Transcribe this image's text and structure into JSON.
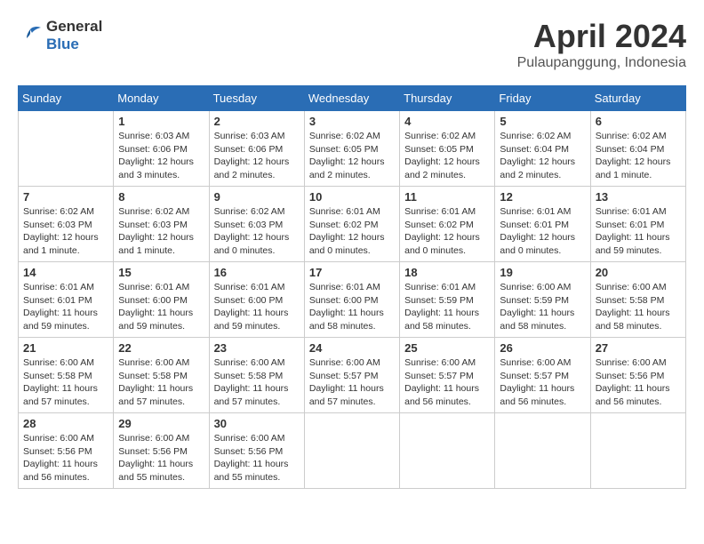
{
  "header": {
    "logo_line1": "General",
    "logo_line2": "Blue",
    "month_title": "April 2024",
    "location": "Pulaupanggung, Indonesia"
  },
  "weekdays": [
    "Sunday",
    "Monday",
    "Tuesday",
    "Wednesday",
    "Thursday",
    "Friday",
    "Saturday"
  ],
  "weeks": [
    [
      {
        "day": "",
        "info": ""
      },
      {
        "day": "1",
        "info": "Sunrise: 6:03 AM\nSunset: 6:06 PM\nDaylight: 12 hours\nand 3 minutes."
      },
      {
        "day": "2",
        "info": "Sunrise: 6:03 AM\nSunset: 6:06 PM\nDaylight: 12 hours\nand 2 minutes."
      },
      {
        "day": "3",
        "info": "Sunrise: 6:02 AM\nSunset: 6:05 PM\nDaylight: 12 hours\nand 2 minutes."
      },
      {
        "day": "4",
        "info": "Sunrise: 6:02 AM\nSunset: 6:05 PM\nDaylight: 12 hours\nand 2 minutes."
      },
      {
        "day": "5",
        "info": "Sunrise: 6:02 AM\nSunset: 6:04 PM\nDaylight: 12 hours\nand 2 minutes."
      },
      {
        "day": "6",
        "info": "Sunrise: 6:02 AM\nSunset: 6:04 PM\nDaylight: 12 hours\nand 1 minute."
      }
    ],
    [
      {
        "day": "7",
        "info": "Sunrise: 6:02 AM\nSunset: 6:03 PM\nDaylight: 12 hours\nand 1 minute."
      },
      {
        "day": "8",
        "info": "Sunrise: 6:02 AM\nSunset: 6:03 PM\nDaylight: 12 hours\nand 1 minute."
      },
      {
        "day": "9",
        "info": "Sunrise: 6:02 AM\nSunset: 6:03 PM\nDaylight: 12 hours\nand 0 minutes."
      },
      {
        "day": "10",
        "info": "Sunrise: 6:01 AM\nSunset: 6:02 PM\nDaylight: 12 hours\nand 0 minutes."
      },
      {
        "day": "11",
        "info": "Sunrise: 6:01 AM\nSunset: 6:02 PM\nDaylight: 12 hours\nand 0 minutes."
      },
      {
        "day": "12",
        "info": "Sunrise: 6:01 AM\nSunset: 6:01 PM\nDaylight: 12 hours\nand 0 minutes."
      },
      {
        "day": "13",
        "info": "Sunrise: 6:01 AM\nSunset: 6:01 PM\nDaylight: 11 hours\nand 59 minutes."
      }
    ],
    [
      {
        "day": "14",
        "info": "Sunrise: 6:01 AM\nSunset: 6:01 PM\nDaylight: 11 hours\nand 59 minutes."
      },
      {
        "day": "15",
        "info": "Sunrise: 6:01 AM\nSunset: 6:00 PM\nDaylight: 11 hours\nand 59 minutes."
      },
      {
        "day": "16",
        "info": "Sunrise: 6:01 AM\nSunset: 6:00 PM\nDaylight: 11 hours\nand 59 minutes."
      },
      {
        "day": "17",
        "info": "Sunrise: 6:01 AM\nSunset: 6:00 PM\nDaylight: 11 hours\nand 58 minutes."
      },
      {
        "day": "18",
        "info": "Sunrise: 6:01 AM\nSunset: 5:59 PM\nDaylight: 11 hours\nand 58 minutes."
      },
      {
        "day": "19",
        "info": "Sunrise: 6:00 AM\nSunset: 5:59 PM\nDaylight: 11 hours\nand 58 minutes."
      },
      {
        "day": "20",
        "info": "Sunrise: 6:00 AM\nSunset: 5:58 PM\nDaylight: 11 hours\nand 58 minutes."
      }
    ],
    [
      {
        "day": "21",
        "info": "Sunrise: 6:00 AM\nSunset: 5:58 PM\nDaylight: 11 hours\nand 57 minutes."
      },
      {
        "day": "22",
        "info": "Sunrise: 6:00 AM\nSunset: 5:58 PM\nDaylight: 11 hours\nand 57 minutes."
      },
      {
        "day": "23",
        "info": "Sunrise: 6:00 AM\nSunset: 5:58 PM\nDaylight: 11 hours\nand 57 minutes."
      },
      {
        "day": "24",
        "info": "Sunrise: 6:00 AM\nSunset: 5:57 PM\nDaylight: 11 hours\nand 57 minutes."
      },
      {
        "day": "25",
        "info": "Sunrise: 6:00 AM\nSunset: 5:57 PM\nDaylight: 11 hours\nand 56 minutes."
      },
      {
        "day": "26",
        "info": "Sunrise: 6:00 AM\nSunset: 5:57 PM\nDaylight: 11 hours\nand 56 minutes."
      },
      {
        "day": "27",
        "info": "Sunrise: 6:00 AM\nSunset: 5:56 PM\nDaylight: 11 hours\nand 56 minutes."
      }
    ],
    [
      {
        "day": "28",
        "info": "Sunrise: 6:00 AM\nSunset: 5:56 PM\nDaylight: 11 hours\nand 56 minutes."
      },
      {
        "day": "29",
        "info": "Sunrise: 6:00 AM\nSunset: 5:56 PM\nDaylight: 11 hours\nand 55 minutes."
      },
      {
        "day": "30",
        "info": "Sunrise: 6:00 AM\nSunset: 5:56 PM\nDaylight: 11 hours\nand 55 minutes."
      },
      {
        "day": "",
        "info": ""
      },
      {
        "day": "",
        "info": ""
      },
      {
        "day": "",
        "info": ""
      },
      {
        "day": "",
        "info": ""
      }
    ]
  ]
}
